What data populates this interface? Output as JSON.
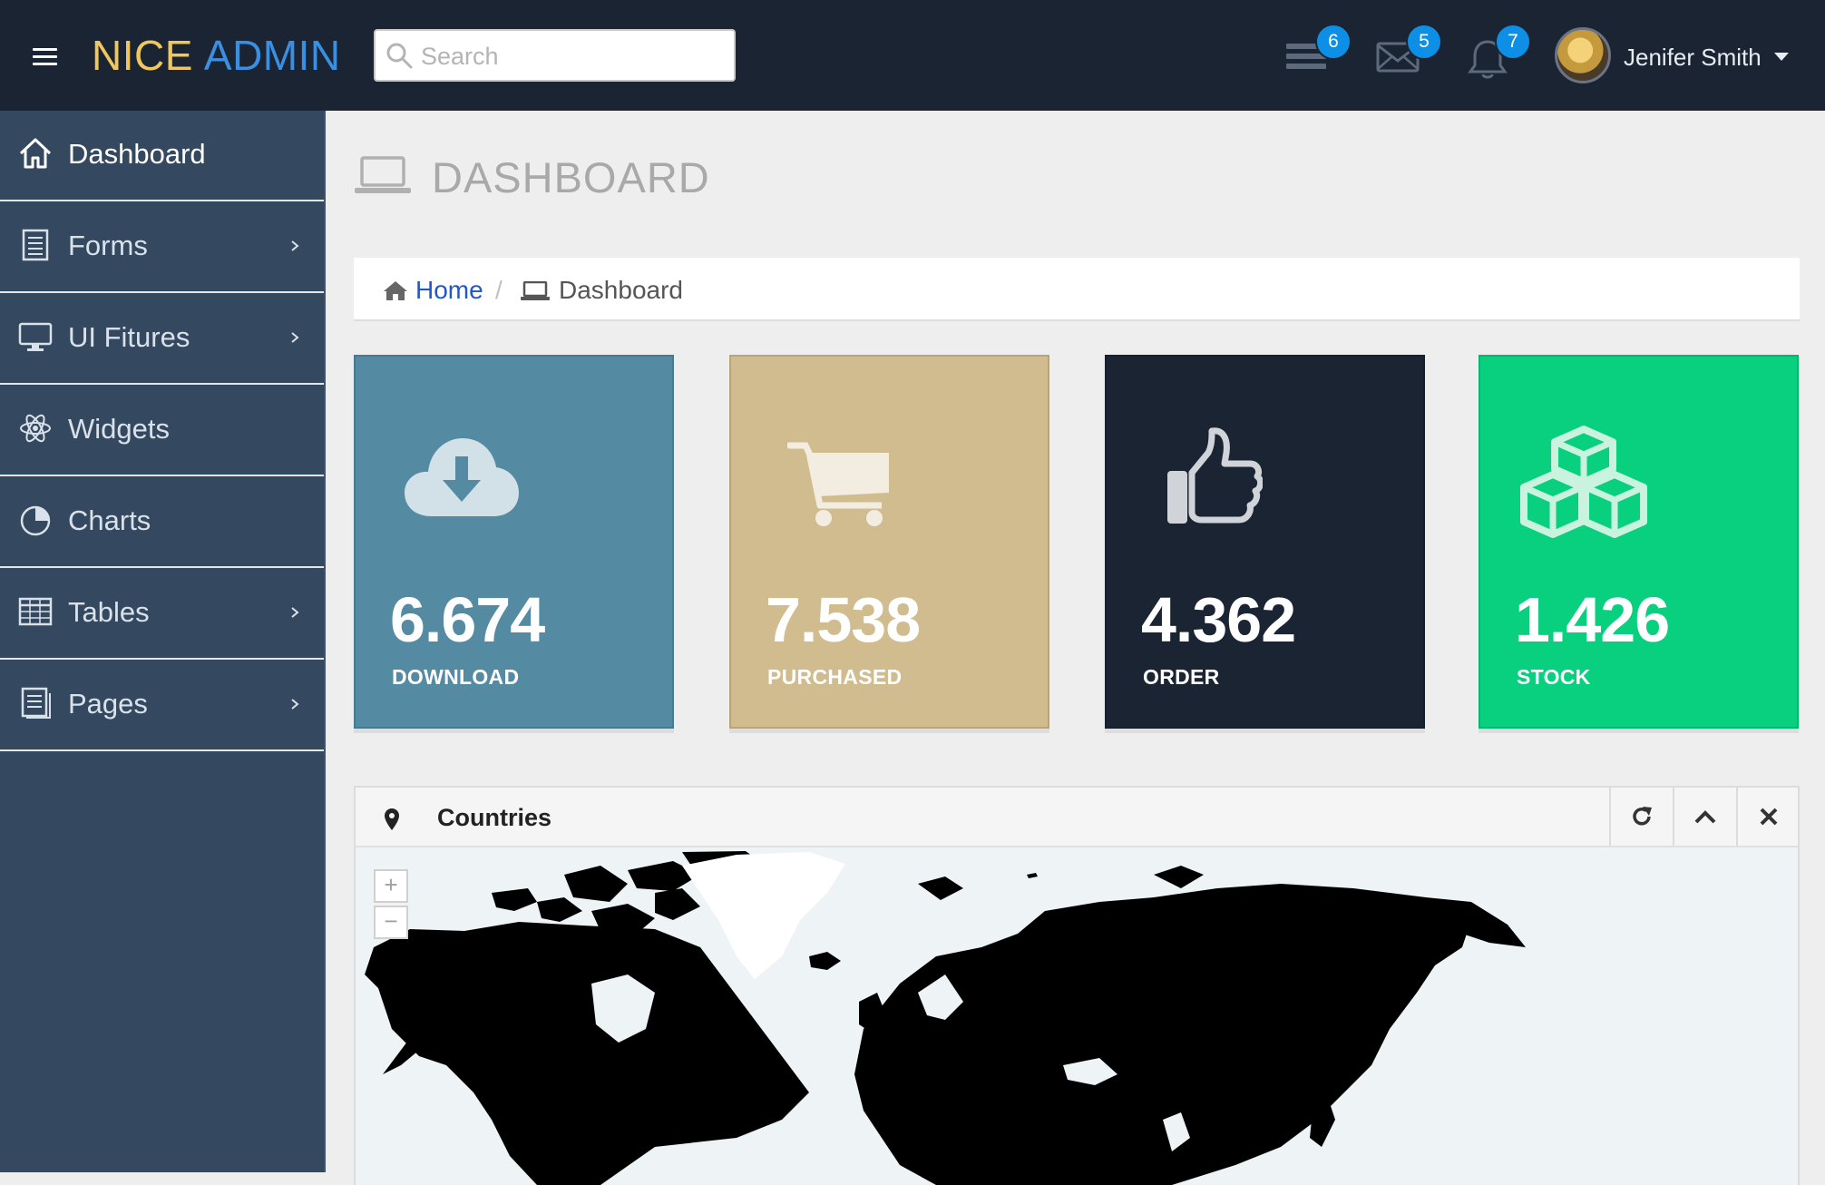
{
  "header": {
    "logo_part1": "NICE",
    "logo_part2": "ADMIN",
    "search_placeholder": "Search",
    "tasks_badge": "6",
    "mail_badge": "5",
    "notifications_badge": "7",
    "user_name": "Jenifer Smith"
  },
  "sidebar": {
    "items": [
      {
        "label": "Dashboard",
        "icon": "home-icon"
      },
      {
        "label": "Forms",
        "icon": "document-icon"
      },
      {
        "label": "UI Fitures",
        "icon": "monitor-icon"
      },
      {
        "label": "Widgets",
        "icon": "atom-icon"
      },
      {
        "label": "Charts",
        "icon": "pie-chart-icon"
      },
      {
        "label": "Tables",
        "icon": "table-icon"
      },
      {
        "label": "Pages",
        "icon": "pages-icon"
      }
    ]
  },
  "page": {
    "title": "DASHBOARD",
    "breadcrumb_home": "Home",
    "breadcrumb_separator": "/",
    "breadcrumb_current": "Dashboard"
  },
  "stats": [
    {
      "value": "6.674",
      "label": "DOWNLOAD",
      "color": "#548aa2",
      "icon": "cloud-download-icon"
    },
    {
      "value": "7.538",
      "label": "PURCHASED",
      "color": "#d0bc8e",
      "icon": "shopping-cart-icon"
    },
    {
      "value": "4.362",
      "label": "ORDER",
      "color": "#1a2433",
      "icon": "thumbs-up-icon"
    },
    {
      "value": "1.426",
      "label": "STOCK",
      "color": "#09d07e",
      "icon": "cubes-icon"
    }
  ],
  "countries_panel": {
    "title": "Countries",
    "zoom_in": "+",
    "zoom_out": "−"
  },
  "colors": {
    "header_bg": "#1a2433",
    "sidebar_bg": "#34485f",
    "badge": "#0e8fe6",
    "link": "#2257c8"
  }
}
